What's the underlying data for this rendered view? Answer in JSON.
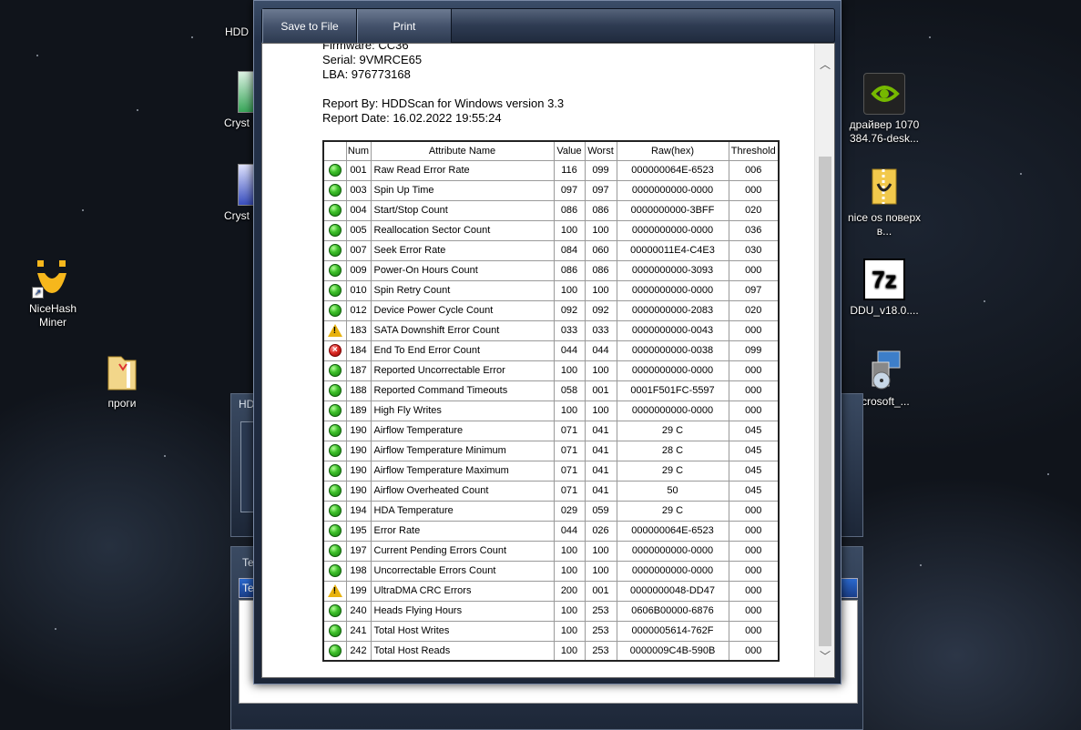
{
  "desktop": {
    "icons": {
      "hdd": "HDD",
      "crystal1": "Cryst",
      "crystal2": "Cryst",
      "nicehash": "NiceHash Miner",
      "progi": "проги",
      "nvidia": "драйвер 1070 384.76-desk...",
      "niceos": "nice os поверх в...",
      "ddu": "DDU_v18.0....",
      "microsoft": "icrosoft_..."
    },
    "bg_window_title_1": "HD",
    "bg_window_title_2": "Te",
    "bg_window_tab": "Te"
  },
  "toolbar": {
    "save_label": "Save to File",
    "print_label": "Print"
  },
  "report": {
    "firmware_partial": "Firmware: CC36",
    "serial": "Serial: 9VMRCE65",
    "lba": "LBA: 976773168",
    "report_by": "Report By: HDDScan for Windows version 3.3",
    "report_date": "Report Date: 16.02.2022 19:55:24"
  },
  "table": {
    "headers": {
      "num": "Num",
      "name": "Attribute Name",
      "value": "Value",
      "worst": "Worst",
      "raw": "Raw(hex)",
      "threshold": "Threshold"
    },
    "rows": [
      {
        "status": "ok",
        "num": "001",
        "name": "Raw Read Error Rate",
        "value": "116",
        "worst": "099",
        "raw": "000000064E-6523",
        "threshold": "006"
      },
      {
        "status": "ok",
        "num": "003",
        "name": "Spin Up Time",
        "value": "097",
        "worst": "097",
        "raw": "0000000000-0000",
        "threshold": "000"
      },
      {
        "status": "ok",
        "num": "004",
        "name": "Start/Stop Count",
        "value": "086",
        "worst": "086",
        "raw": "0000000000-3BFF",
        "threshold": "020"
      },
      {
        "status": "ok",
        "num": "005",
        "name": "Reallocation Sector Count",
        "value": "100",
        "worst": "100",
        "raw": "0000000000-0000",
        "threshold": "036"
      },
      {
        "status": "ok",
        "num": "007",
        "name": "Seek Error Rate",
        "value": "084",
        "worst": "060",
        "raw": "00000011E4-C4E3",
        "threshold": "030"
      },
      {
        "status": "ok",
        "num": "009",
        "name": "Power-On Hours Count",
        "value": "086",
        "worst": "086",
        "raw": "0000000000-3093",
        "threshold": "000"
      },
      {
        "status": "ok",
        "num": "010",
        "name": "Spin Retry Count",
        "value": "100",
        "worst": "100",
        "raw": "0000000000-0000",
        "threshold": "097"
      },
      {
        "status": "ok",
        "num": "012",
        "name": "Device Power Cycle Count",
        "value": "092",
        "worst": "092",
        "raw": "0000000000-2083",
        "threshold": "020"
      },
      {
        "status": "warn",
        "num": "183",
        "name": "SATA Downshift Error Count",
        "value": "033",
        "worst": "033",
        "raw": "0000000000-0043",
        "threshold": "000"
      },
      {
        "status": "err",
        "num": "184",
        "name": "End To End Error Count",
        "value": "044",
        "worst": "044",
        "raw": "0000000000-0038",
        "threshold": "099"
      },
      {
        "status": "ok",
        "num": "187",
        "name": "Reported Uncorrectable Error",
        "value": "100",
        "worst": "100",
        "raw": "0000000000-0000",
        "threshold": "000"
      },
      {
        "status": "ok",
        "num": "188",
        "name": "Reported Command Timeouts",
        "value": "058",
        "worst": "001",
        "raw": "0001F501FC-5597",
        "threshold": "000"
      },
      {
        "status": "ok",
        "num": "189",
        "name": "High Fly Writes",
        "value": "100",
        "worst": "100",
        "raw": "0000000000-0000",
        "threshold": "000"
      },
      {
        "status": "ok",
        "num": "190",
        "name": "Airflow Temperature",
        "value": "071",
        "worst": "041",
        "raw": "29 C",
        "threshold": "045"
      },
      {
        "status": "ok",
        "num": "190",
        "name": "Airflow Temperature Minimum",
        "value": "071",
        "worst": "041",
        "raw": "28 C",
        "threshold": "045"
      },
      {
        "status": "ok",
        "num": "190",
        "name": "Airflow Temperature Maximum",
        "value": "071",
        "worst": "041",
        "raw": "29 C",
        "threshold": "045"
      },
      {
        "status": "ok",
        "num": "190",
        "name": "Airflow Overheated Count",
        "value": "071",
        "worst": "041",
        "raw": "50",
        "threshold": "045"
      },
      {
        "status": "ok",
        "num": "194",
        "name": "HDA Temperature",
        "value": "029",
        "worst": "059",
        "raw": "29 C",
        "threshold": "000"
      },
      {
        "status": "ok",
        "num": "195",
        "name": "Error Rate",
        "value": "044",
        "worst": "026",
        "raw": "000000064E-6523",
        "threshold": "000"
      },
      {
        "status": "ok",
        "num": "197",
        "name": "Current Pending Errors Count",
        "value": "100",
        "worst": "100",
        "raw": "0000000000-0000",
        "threshold": "000"
      },
      {
        "status": "ok",
        "num": "198",
        "name": "Uncorrectable Errors Count",
        "value": "100",
        "worst": "100",
        "raw": "0000000000-0000",
        "threshold": "000"
      },
      {
        "status": "warn",
        "num": "199",
        "name": "UltraDMA CRC Errors",
        "value": "200",
        "worst": "001",
        "raw": "0000000048-DD47",
        "threshold": "000"
      },
      {
        "status": "ok",
        "num": "240",
        "name": "Heads Flying Hours",
        "value": "100",
        "worst": "253",
        "raw": "0606B00000-6876",
        "threshold": "000"
      },
      {
        "status": "ok",
        "num": "241",
        "name": "Total Host Writes",
        "value": "100",
        "worst": "253",
        "raw": "0000005614-762F",
        "threshold": "000"
      },
      {
        "status": "ok",
        "num": "242",
        "name": "Total Host Reads",
        "value": "100",
        "worst": "253",
        "raw": "0000009C4B-590B",
        "threshold": "000"
      }
    ]
  },
  "colors": {
    "ok": "#3fc12b",
    "warn": "#e8b20e",
    "err": "#d9241e",
    "nvidia_green": "#76b900",
    "nicehash_yellow": "#f6b71c"
  }
}
